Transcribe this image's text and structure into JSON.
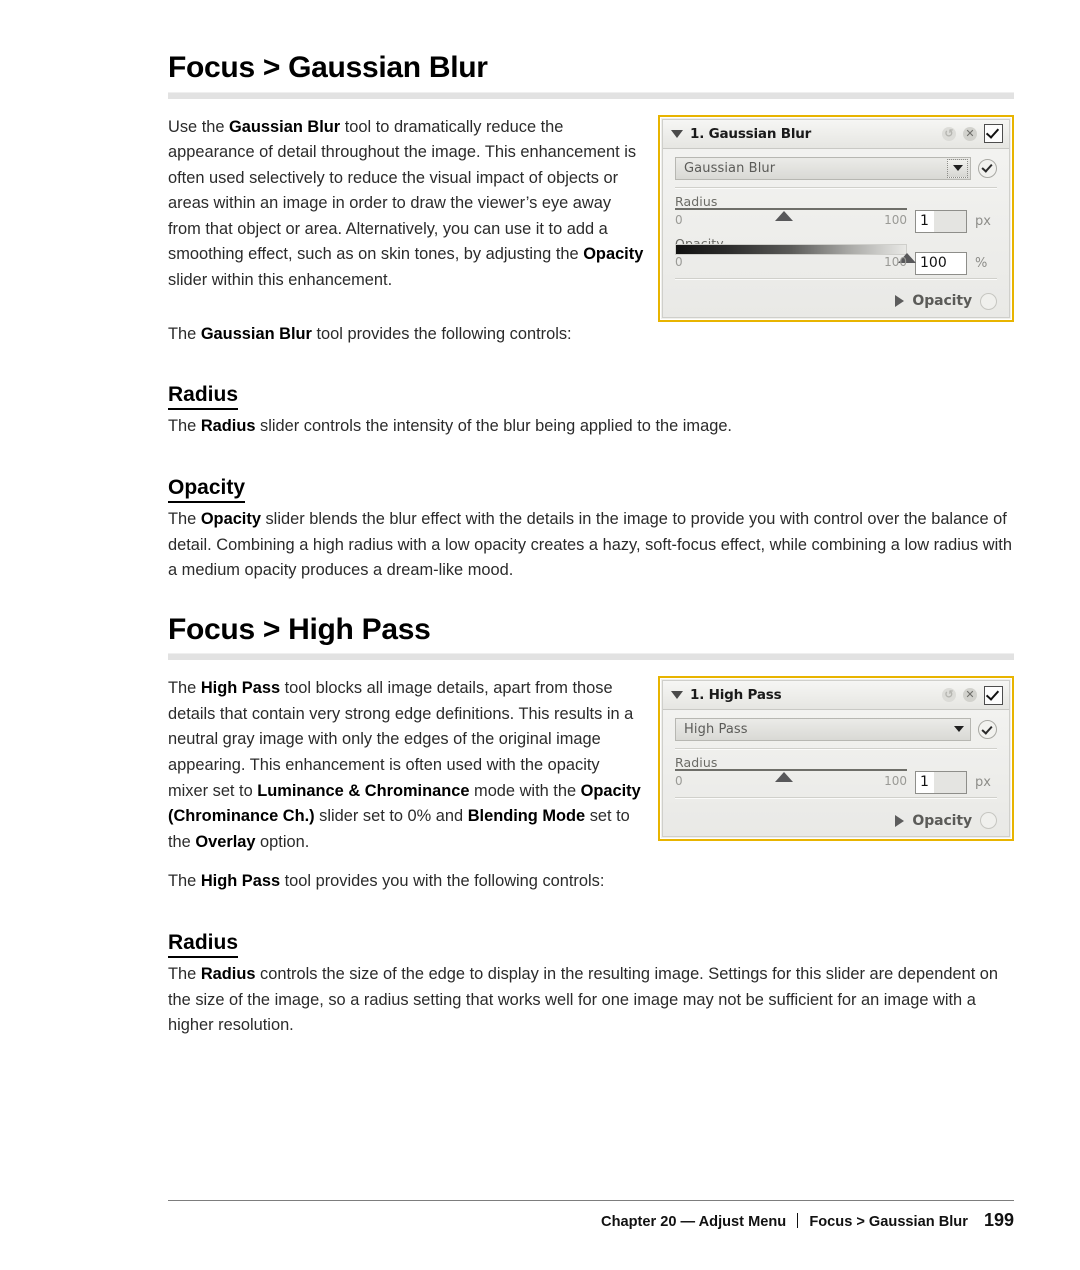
{
  "page": {
    "number": "199",
    "footer_chapter": "Chapter 20 — Adjust Menu",
    "footer_path": "Focus > Gaussian Blur"
  },
  "sections": [
    {
      "title": "Focus > Gaussian Blur",
      "intro": "Use the <b>Gaussian Blur</b> tool to dramatically reduce the appearance of detail throughout the image. This enhancement is often used selectively to reduce the visual impact of objects or areas within an image in order to draw the viewer’s eye away from that object or area. Alternatively, you can use it to add a smoothing effect, such as on skin tones, by adjusting the <b>Opacity</b> slider within this enhancement.",
      "lead": "The <b>Gaussian Blur</b> tool provides the following controls:",
      "subsections": [
        {
          "heading": "Radius",
          "text": "The <b>Radius</b> slider controls the intensity of the blur being applied to the image."
        },
        {
          "heading": "Opacity",
          "text": "The <b>Opacity</b> slider blends the blur effect with the details in the image to provide you with control over the balance of detail. Combining a high radius with a low opacity creates a hazy, soft-focus effect, while combining a low radius with a medium opacity produces a dream-like mood."
        }
      ]
    },
    {
      "title": "Focus > High Pass",
      "intro": "The <b>High Pass</b> tool blocks all image details, apart from those details that contain very strong edge definitions. This results in a neutral gray image with only the edges of the original image appearing. This enhancement is often used with the opacity mixer set to <b>Luminance &amp; Chrominance</b> mode with the <b>Opacity (Chrominance Ch.)</b> slider set to 0% and <b>Blending Mode</b> set to the <b>Overlay</b> option.",
      "lead": "The <b>High Pass</b> tool provides you with the following controls:",
      "subsections": [
        {
          "heading": "Radius",
          "text": "The <b>Radius</b> controls the size of the edge to display in the resulting image. Settings for this slider are dependent on the size of the image, so a radius setting that works well for one image may not be sufficient for an image with a higher resolution."
        }
      ]
    }
  ],
  "panels": [
    {
      "title": "1. Gaussian Blur",
      "combo_value": "Gaussian Blur",
      "icons": {
        "collapse": "triangle-down-icon",
        "reset": "reset-icon",
        "delete": "delete-x-icon",
        "enable": "checkbox-checked-icon",
        "combo_arrow": "chevron-down-icon",
        "combo_apply": "circle-check-icon",
        "footer_expander": "triangle-right-icon",
        "footer_circle": "circle-empty-icon"
      },
      "sliders": [
        {
          "label": "Radius",
          "min": "0",
          "max": "100",
          "value": "1",
          "unit": "px",
          "thumb_percent": 47,
          "style": "line"
        },
        {
          "label": "Opacity",
          "min": "0",
          "max": "100",
          "value": "100",
          "unit": "%",
          "thumb_percent": 100,
          "style": "gradient"
        }
      ],
      "footer_label": "Opacity"
    },
    {
      "title": "1. High Pass",
      "combo_value": "High Pass",
      "icons": {
        "collapse": "triangle-down-icon",
        "reset": "reset-icon",
        "delete": "delete-x-icon",
        "enable": "checkbox-checked-icon",
        "combo_arrow": "chevron-down-icon",
        "combo_apply": "circle-check-icon",
        "footer_expander": "triangle-right-icon",
        "footer_circle": "circle-empty-icon"
      },
      "sliders": [
        {
          "label": "Radius",
          "min": "0",
          "max": "100",
          "value": "1",
          "unit": "px",
          "thumb_percent": 47,
          "style": "line"
        }
      ],
      "footer_label": "Opacity"
    }
  ],
  "colors": {
    "panel_border": "#e8b400",
    "heading_rule": "#e2e2e2",
    "text": "#2b2b2b"
  }
}
